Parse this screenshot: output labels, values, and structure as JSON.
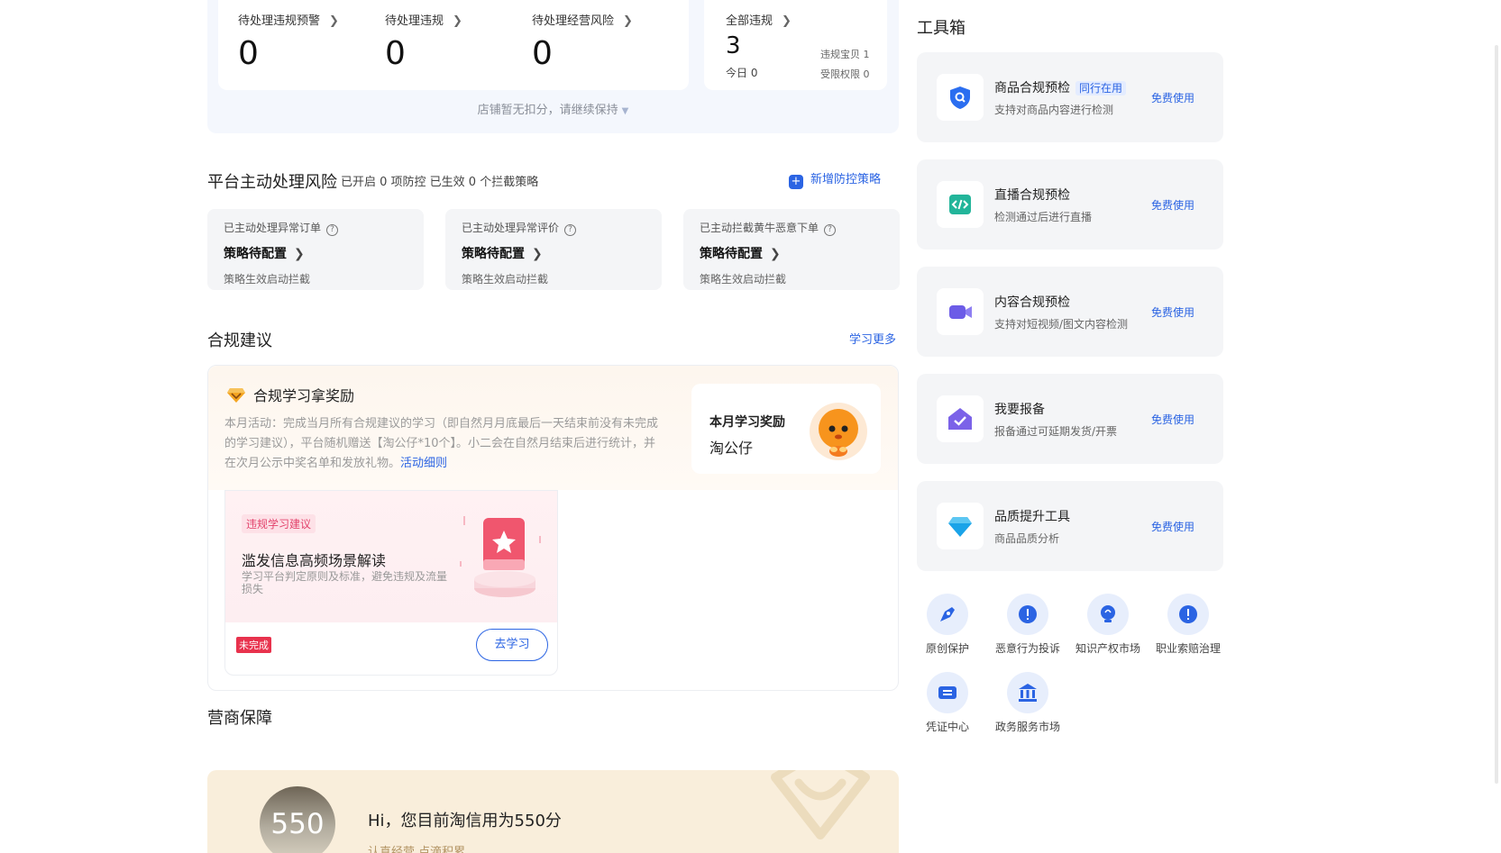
{
  "summary": {
    "items": [
      {
        "label": "待处理违规预警",
        "value": "0"
      },
      {
        "label": "待处理违规",
        "value": "0"
      },
      {
        "label": "待处理经营风险",
        "value": "0"
      }
    ],
    "all": {
      "label": "全部违规",
      "value": "3",
      "today": "今日 0",
      "r1": "违规宝贝 1",
      "r2": "受限权限 0"
    },
    "hint": "店铺暂无扣分，请继续保持"
  },
  "platform": {
    "title": "平台主动处理风险",
    "subtitle": "已开启 0 项防控 已生效 0 个拦截策略",
    "add_label": "新增防控策略",
    "cards": [
      {
        "title": "已主动处理异常订单",
        "status": "策略待配置",
        "desc": "策略生效启动拦截"
      },
      {
        "title": "已主动处理异常评价",
        "status": "策略待配置",
        "desc": "策略生效启动拦截"
      },
      {
        "title": "已主动拦截黄牛恶意下单",
        "status": "策略待配置",
        "desc": "策略生效启动拦截"
      }
    ]
  },
  "compliance": {
    "title": "合规建议",
    "more": "学习更多",
    "promo_title": "合规学习拿奖励",
    "promo_desc": "本月活动：完成当月所有合规建议的学习（即自然月月底最后一天结束前没有未完成的学习建议），平台随机赠送【淘公仔*10个】。小二会在自然月结束后进行统计，并在次月公示中奖名单和发放礼物。",
    "promo_link": "活动细则",
    "reward_title": "本月学习奖励",
    "reward_value": "淘公仔",
    "study": {
      "tag": "违规学习建议",
      "title": "滥发信息高频场景解读",
      "desc": "学习平台判定原则及标准，避免违规及流量损失",
      "status": "未完成",
      "button": "去学习"
    }
  },
  "merchant": {
    "title": "营商保障",
    "score": "550",
    "hi": "Hi，您目前淘信用为550分",
    "sub": "认真经营 点滴积累"
  },
  "toolbox": {
    "title": "工具箱",
    "tools": [
      {
        "name": "商品合规预检",
        "badge": "同行在用",
        "desc": "支持对商品内容进行检测",
        "use": "免费使用",
        "icon": "shield-search-icon",
        "color": "#2b6ef0"
      },
      {
        "name": "直播合规预检",
        "badge": "",
        "desc": "检测通过后进行直播",
        "use": "免费使用",
        "icon": "code-icon",
        "color": "#22b59a"
      },
      {
        "name": "内容合规预检",
        "badge": "",
        "desc": "支持对短视频/图文内容检测",
        "use": "免费使用",
        "icon": "video-icon",
        "color": "#6c5ce7"
      },
      {
        "name": "我要报备",
        "badge": "",
        "desc": "报备通过可延期发货/开票",
        "use": "免费使用",
        "icon": "house-check-icon",
        "color": "#7b62e8"
      },
      {
        "name": "品质提升工具",
        "badge": "",
        "desc": "商品品质分析",
        "use": "免费使用",
        "icon": "diamond-icon",
        "color": "#1aa3e8"
      }
    ],
    "quick": [
      {
        "label": "原创保护",
        "icon": "original-icon"
      },
      {
        "label": "恶意行为投诉",
        "icon": "complaint-icon"
      },
      {
        "label": "知识产权市场",
        "icon": "ip-icon"
      },
      {
        "label": "职业索赔治理",
        "icon": "claim-icon"
      },
      {
        "label": "凭证中心",
        "icon": "voucher-icon"
      },
      {
        "label": "政务服务市场",
        "icon": "gov-icon"
      }
    ]
  }
}
